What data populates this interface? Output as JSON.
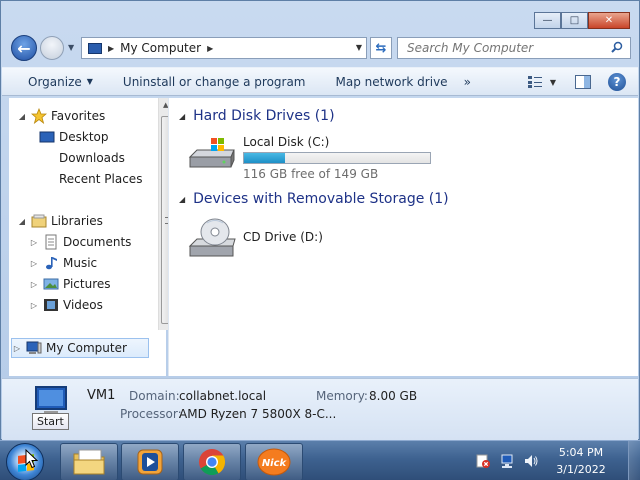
{
  "window": {
    "caption_minimize": "—",
    "caption_maximize": "□",
    "caption_close": "✕"
  },
  "address": {
    "location": "My Computer",
    "search_placeholder": "Search My Computer"
  },
  "toolbar": {
    "organize": "Organize",
    "uninstall": "Uninstall or change a program",
    "map_drive": "Map network drive",
    "more": "»"
  },
  "navigation": {
    "favorites": "Favorites",
    "desktop": "Desktop",
    "downloads": "Downloads",
    "recent_places": "Recent Places",
    "libraries": "Libraries",
    "documents": "Documents",
    "music": "Music",
    "pictures": "Pictures",
    "videos": "Videos",
    "my_computer": "My Computer"
  },
  "content": {
    "hdd_header": "Hard Disk Drives (1)",
    "removable_header": "Devices with Removable Storage (1)",
    "local_disk": {
      "name": "Local Disk (C:)",
      "free_text": "116 GB free of 149 GB",
      "used_fraction": 0.22
    },
    "cd_drive": {
      "name": "CD Drive (D:)"
    }
  },
  "details": {
    "computer_name": "VM1",
    "domain_label": "Domain:",
    "domain_value": "collabnet.local",
    "memory_label": "Memory:",
    "memory_value": "8.00 GB",
    "processor_label": "Processor:",
    "processor_value": "AMD Ryzen 7 5800X 8-C..."
  },
  "taskbar": {
    "start_tooltip": "Start",
    "time": "5:04 PM",
    "date": "3/1/2022",
    "pinned": [
      "windows-explorer",
      "media-player",
      "chrome",
      "nick"
    ]
  },
  "colors": {
    "accent": "#1e3287",
    "bar_fill": "#1e8fc6",
    "taskbar": "#3e6290"
  }
}
